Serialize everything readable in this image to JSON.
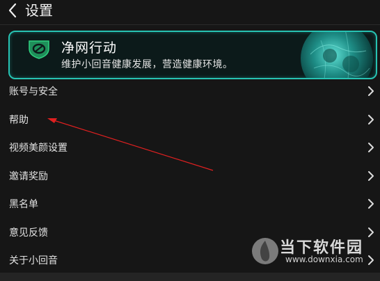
{
  "header": {
    "title": "设置"
  },
  "banner": {
    "title": "净网行动",
    "subtitle": "维护小回音健康发展，营造健康环境。"
  },
  "menu": {
    "items": [
      {
        "label": "账号与安全"
      },
      {
        "label": "帮助"
      },
      {
        "label": "视频美颜设置"
      },
      {
        "label": "邀请奖励"
      },
      {
        "label": "黑名单"
      },
      {
        "label": "意见反馈"
      },
      {
        "label": "关于小回音"
      }
    ]
  },
  "watermark": {
    "name": "当下软件园",
    "url": "www.downxia.com"
  },
  "colors": {
    "accent": "#27c3b3",
    "arrow": "#e02020",
    "background": "#161616"
  }
}
